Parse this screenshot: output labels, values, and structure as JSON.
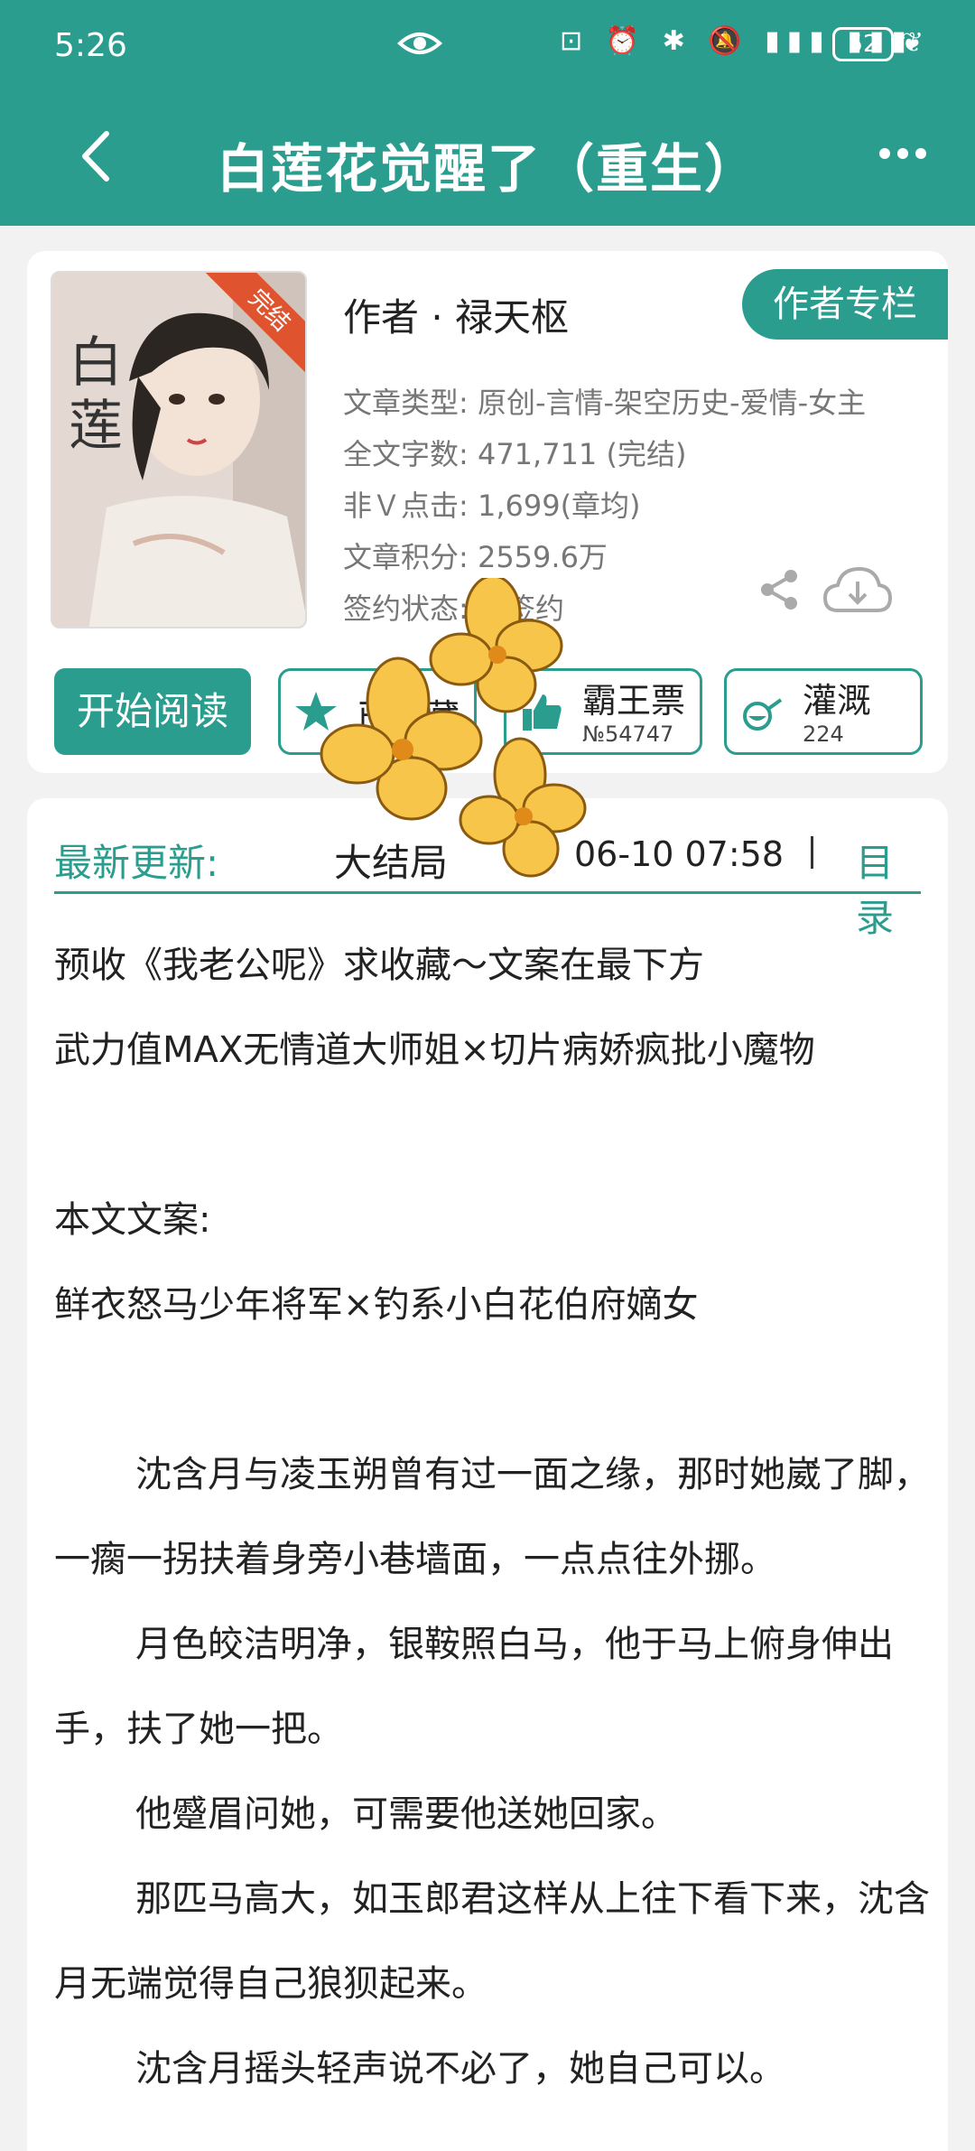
{
  "status_bar": {
    "time": "5:26",
    "battery": "52"
  },
  "header": {
    "title": "白莲花觉醒了（重生）"
  },
  "book": {
    "cover_badge": "完结",
    "author_line": "作者 · 禄天枢",
    "author_column_button": "作者专栏",
    "meta": [
      "文章类型: 原创-言情-架空历史-爱情-女主",
      "全文字数: 471,711 (完结)",
      "非Ｖ点击: 1,699(章均)",
      "文章积分: 2559.6万",
      "签约状态: 已签约"
    ],
    "buttons": {
      "read": "开始阅读",
      "favorite": "已收藏",
      "vote_label": "霸王票",
      "vote_rank": "№54747",
      "water_label": "灌溉",
      "water_count": "224"
    }
  },
  "latest": {
    "label": "最新更新:",
    "chapter": "大结局",
    "date": "06-10 07:58",
    "toc": "目录"
  },
  "content": {
    "paragraphs": [
      {
        "text": "预收《我老公呢》求收藏～文案在最下方",
        "indent": false
      },
      {
        "text": "武力值MAX无情道大师姐×切片病娇疯批小魔物",
        "indent": false
      },
      {
        "text": "",
        "indent": false
      },
      {
        "text": "本文文案:",
        "indent": false
      },
      {
        "text": "鲜衣怒马少年将军×钓系小白花伯府嫡女",
        "indent": false
      },
      {
        "text": "",
        "indent": false
      },
      {
        "text": "沈含月与凌玉朔曾有过一面之缘，那时她崴了脚，一瘸一拐扶着身旁小巷墙面，一点点往外挪。",
        "indent": true
      },
      {
        "text": "月色皎洁明净，银鞍照白马，他于马上俯身伸出手，扶了她一把。",
        "indent": true
      },
      {
        "text": "他蹙眉问她，可需要他送她回家。",
        "indent": true
      },
      {
        "text": "那匹马高大，如玉郎君这样从上往下看下来，沈含月无端觉得自己狼狈起来。",
        "indent": true
      },
      {
        "text": "沈含月摇头轻声说不必了，她自己可以。",
        "indent": true
      }
    ]
  },
  "colors": {
    "accent": "#2a9d8f",
    "badge": "#e0532f"
  }
}
